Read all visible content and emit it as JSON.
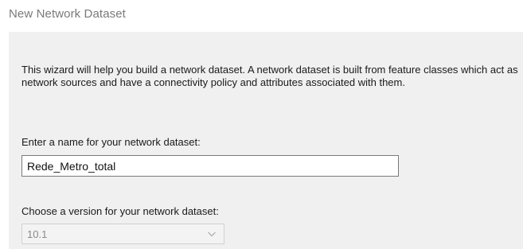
{
  "window": {
    "title": "New Network Dataset"
  },
  "wizard": {
    "intro_text": "This wizard will help you build a network dataset. A network dataset is built from feature classes which act as network sources and have a connectivity policy and attributes associated with them.",
    "name_label": "Enter a name for your network dataset:",
    "name_value": "Rede_Metro_total",
    "version_label": "Choose a version for your network dataset:",
    "version_value": "10.1",
    "version_enabled": false
  },
  "icons": {
    "dropdown": "chevron-down-icon"
  },
  "colors": {
    "background": "#f0f0f0",
    "title_text": "#7a7a7a",
    "disabled_text": "#8a8a8a"
  }
}
